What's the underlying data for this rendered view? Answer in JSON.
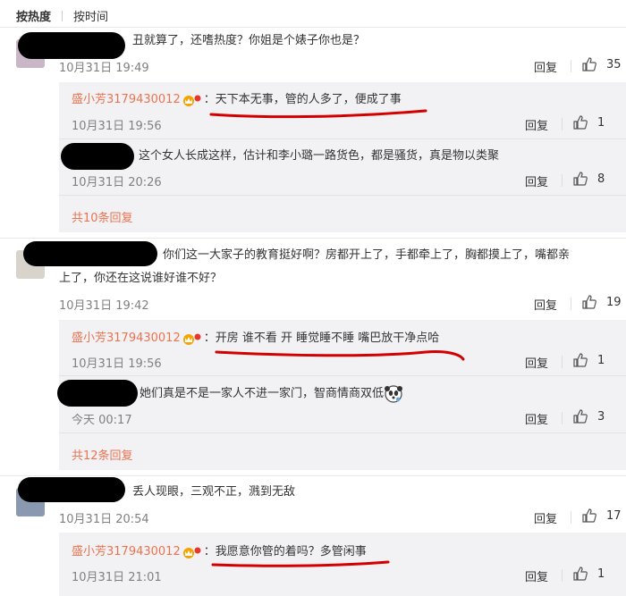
{
  "sort_tabs": {
    "hot": "按热度",
    "time": "按时间"
  },
  "comments": [
    {
      "text": "丑就算了，还嗜热度？你姐是个婊子你也是？",
      "time": "10月31日 19:49",
      "reply": "回复",
      "likes": "35",
      "replies": [
        {
          "user": "盛小芳3179430012",
          "text": "：天下本无事，管的人多了，便成了事",
          "time": "10月31日 19:56",
          "reply": "回复",
          "likes": "1"
        },
        {
          "text": "这个女人长成这样，估计和李小璐一路货色，都是骚货，真是物以类聚",
          "time": "10月31日 20:26",
          "reply": "回复",
          "likes": "8"
        }
      ],
      "more": "共10条回复"
    },
    {
      "text_line1": "你们这一大家子的教育挺好啊？房都开上了，手都牵上了，胸都摸上了，嘴都亲",
      "text_line2": "上了，你还在这说谁好谁不好？",
      "time": "10月31日 19:42",
      "reply": "回复",
      "likes": "19",
      "replies": [
        {
          "user": "盛小芳3179430012",
          "text": "：开房 谁不看 开 睡觉睡不睡 嘴巴放干净点哈",
          "time": "10月31日 19:56",
          "reply": "回复",
          "likes": "1"
        },
        {
          "text": "她们真是不是一家人不进一家门，智商情商双低",
          "time": "今天 00:17",
          "reply": "回复",
          "likes": "3"
        }
      ],
      "more": "共12条回复"
    },
    {
      "text": "丢人现眼，三观不正，溅到无敌",
      "time": "10月31日 20:54",
      "reply": "回复",
      "likes": "17",
      "replies": [
        {
          "user": "盛小芳3179430012",
          "text": "：我愿意你管的着吗？多管闲事",
          "time": "10月31日 21:01",
          "reply": "回复",
          "likes": "1"
        }
      ]
    }
  ],
  "colors": {
    "username": "#eb7350",
    "annotation": "#d40000",
    "reply_bg": "#f2f2f5"
  },
  "icons": {
    "like": "thumbs-up-icon",
    "badge": "vip-crown-icon",
    "emoji": "panda-emoji-icon"
  }
}
